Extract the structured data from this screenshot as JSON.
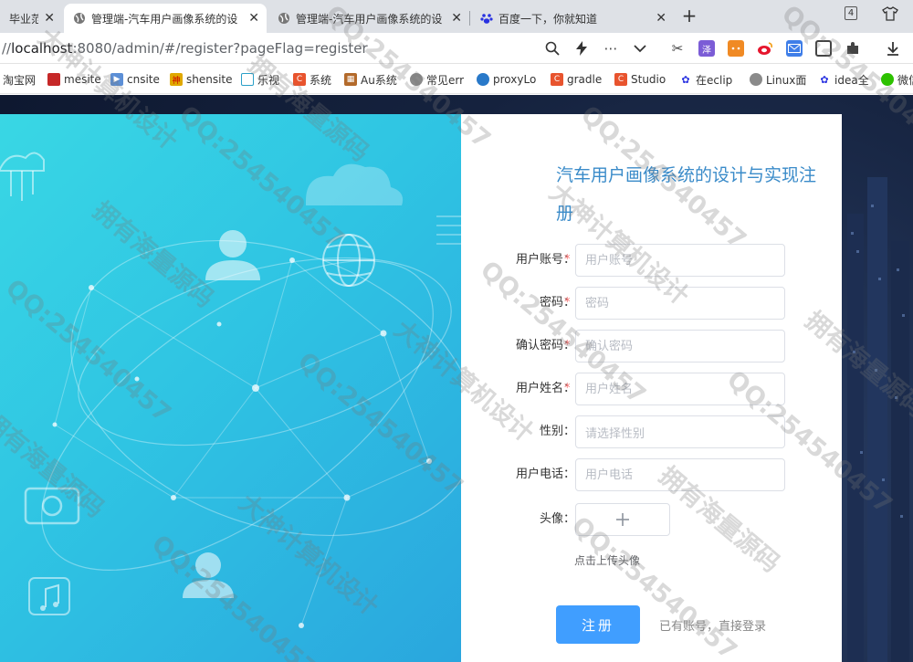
{
  "browser": {
    "tabs": [
      {
        "title": "毕业范"
      },
      {
        "title": "管理端-汽车用户画像系统的设"
      },
      {
        "title": "管理端-汽车用户画像系统的设"
      },
      {
        "title": "百度一下，你就知道"
      }
    ],
    "tab_count": "4",
    "url_prefix": "//",
    "url_host": "localhost",
    "url_rest": ":8080/admin/#/register?pageFlag=register",
    "bookmarks": [
      {
        "label": "淘宝网"
      },
      {
        "label": "mesite"
      },
      {
        "label": "cnsite"
      },
      {
        "label": "shensite"
      },
      {
        "label": "乐视"
      },
      {
        "label": "系统"
      },
      {
        "label": "Au系统"
      },
      {
        "label": "常见err"
      },
      {
        "label": "proxyLo"
      },
      {
        "label": "gradle"
      },
      {
        "label": "Studio"
      },
      {
        "label": "在eclip"
      },
      {
        "label": "Linux面"
      },
      {
        "label": "idea全"
      },
      {
        "label": "微信"
      }
    ]
  },
  "form": {
    "title": "汽车用户画像系统的设计与实现注册",
    "required_mark": "*",
    "fields": {
      "account": {
        "label": "用户账号：",
        "placeholder": "用户账号"
      },
      "password": {
        "label": "密码：",
        "placeholder": "密码"
      },
      "confirm": {
        "label": "确认密码：",
        "placeholder": "确认密码"
      },
      "name": {
        "label": "用户姓名：",
        "placeholder": "用户姓名"
      },
      "gender": {
        "label": "性别：",
        "placeholder": "请选择性别"
      },
      "phone": {
        "label": "用户电话：",
        "placeholder": "用户电话"
      },
      "avatar": {
        "label": "头像："
      }
    },
    "upload_tip": "点击上传头像",
    "submit_label": "注册",
    "login_link": "已有账号，直接登录"
  },
  "watermark": {
    "lines": [
      "QQ:254540457",
      "大神计算机设计",
      "拥有海量源码"
    ]
  },
  "colors": {
    "primary": "#409eff",
    "title": "#3a8bc9",
    "required": "#f56c6c",
    "panel_start": "#39d7e4",
    "panel_end": "#2aa6de",
    "bg_dark": "#15223e"
  }
}
